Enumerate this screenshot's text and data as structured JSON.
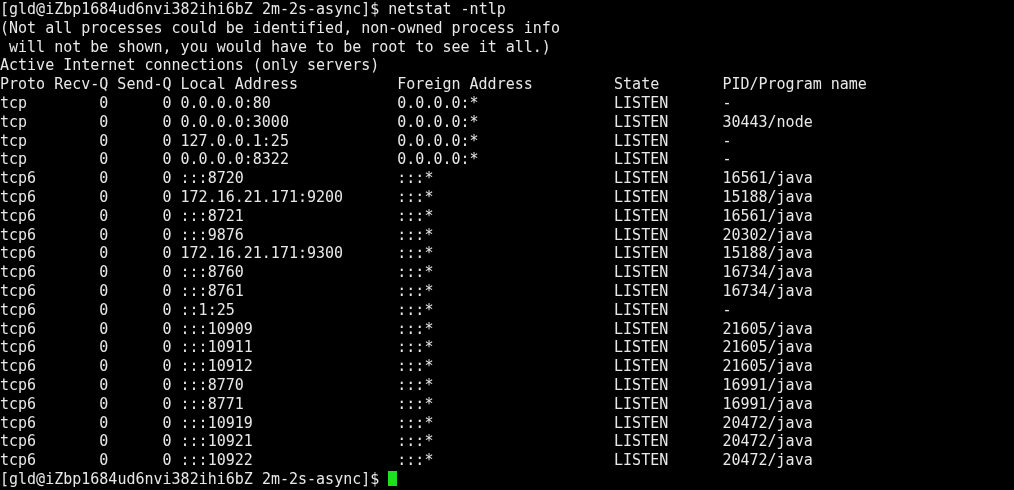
{
  "prompt": {
    "text": "[gld@iZbp1684ud6nvi382ihi6bZ 2m-2s-async]$ netstat -ntlp"
  },
  "messages": [
    "(Not all processes could be identified, non-owned process info",
    " will not be shown, you would have to be root to see it all.)",
    "Active Internet connections (only servers)"
  ],
  "table": {
    "columns": [
      "Proto",
      "Recv-Q",
      "Send-Q",
      "Local Address",
      "Foreign Address",
      "State",
      "PID/Program name"
    ],
    "rows": [
      [
        "tcp",
        "0",
        "0",
        "0.0.0.0:80",
        "0.0.0.0:*",
        "LISTEN",
        "-"
      ],
      [
        "tcp",
        "0",
        "0",
        "0.0.0.0:3000",
        "0.0.0.0:*",
        "LISTEN",
        "30443/node"
      ],
      [
        "tcp",
        "0",
        "0",
        "127.0.0.1:25",
        "0.0.0.0:*",
        "LISTEN",
        "-"
      ],
      [
        "tcp",
        "0",
        "0",
        "0.0.0.0:8322",
        "0.0.0.0:*",
        "LISTEN",
        "-"
      ],
      [
        "tcp6",
        "0",
        "0",
        ":::8720",
        ":::*",
        "LISTEN",
        "16561/java"
      ],
      [
        "tcp6",
        "0",
        "0",
        "172.16.21.171:9200",
        ":::*",
        "LISTEN",
        "15188/java"
      ],
      [
        "tcp6",
        "0",
        "0",
        ":::8721",
        ":::*",
        "LISTEN",
        "16561/java"
      ],
      [
        "tcp6",
        "0",
        "0",
        ":::9876",
        ":::*",
        "LISTEN",
        "20302/java"
      ],
      [
        "tcp6",
        "0",
        "0",
        "172.16.21.171:9300",
        ":::*",
        "LISTEN",
        "15188/java"
      ],
      [
        "tcp6",
        "0",
        "0",
        ":::8760",
        ":::*",
        "LISTEN",
        "16734/java"
      ],
      [
        "tcp6",
        "0",
        "0",
        ":::8761",
        ":::*",
        "LISTEN",
        "16734/java"
      ],
      [
        "tcp6",
        "0",
        "0",
        "::1:25",
        ":::*",
        "LISTEN",
        "-"
      ],
      [
        "tcp6",
        "0",
        "0",
        ":::10909",
        ":::*",
        "LISTEN",
        "21605/java"
      ],
      [
        "tcp6",
        "0",
        "0",
        ":::10911",
        ":::*",
        "LISTEN",
        "21605/java"
      ],
      [
        "tcp6",
        "0",
        "0",
        ":::10912",
        ":::*",
        "LISTEN",
        "21605/java"
      ],
      [
        "tcp6",
        "0",
        "0",
        ":::8770",
        ":::*",
        "LISTEN",
        "16991/java"
      ],
      [
        "tcp6",
        "0",
        "0",
        ":::8771",
        ":::*",
        "LISTEN",
        "16991/java"
      ],
      [
        "tcp6",
        "0",
        "0",
        ":::10919",
        ":::*",
        "LISTEN",
        "20472/java"
      ],
      [
        "tcp6",
        "0",
        "0",
        ":::10921",
        ":::*",
        "LISTEN",
        "20472/java"
      ],
      [
        "tcp6",
        "0",
        "0",
        ":::10922",
        ":::*",
        "LISTEN",
        "20472/java"
      ]
    ]
  },
  "last_prompt": {
    "text": "[gld@iZbp1684ud6nvi382ihi6bZ 2m-2s-async]$"
  }
}
